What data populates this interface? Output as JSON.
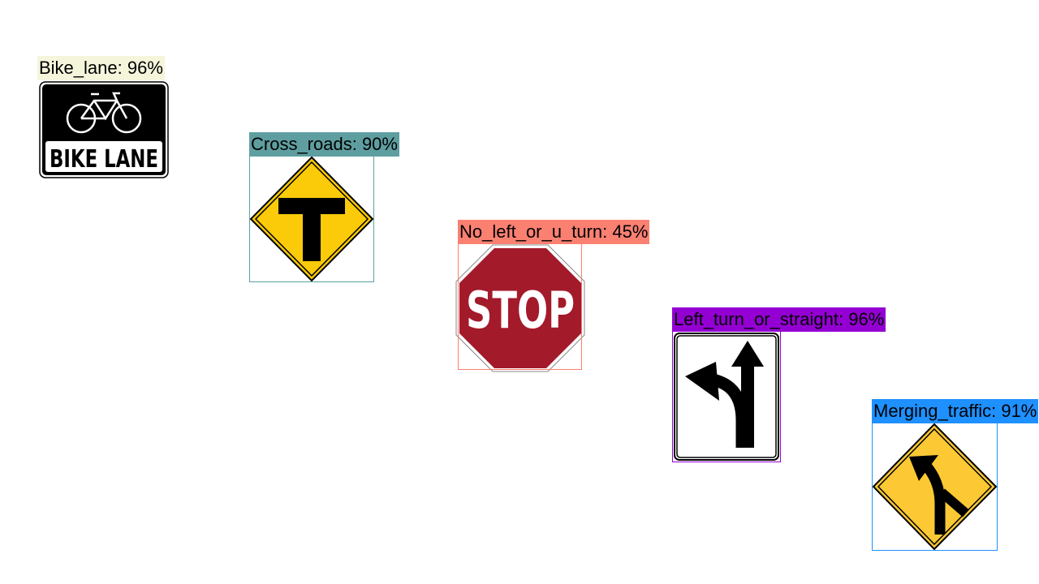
{
  "detections": [
    {
      "label": "Bike_lane: 96%",
      "color": "#f5f5dc",
      "sign_icon": "bike-lane-sign",
      "sign_text": "BIKE LANE"
    },
    {
      "label": "Cross_roads: 90%",
      "color": "#5f9ea0",
      "sign_icon": "t-intersection-sign"
    },
    {
      "label": "No_left_or_u_turn: 45%",
      "color": "#fa8072",
      "sign_icon": "stop-sign",
      "sign_text": "STOP"
    },
    {
      "label": "Left_turn_or_straight: 96%",
      "color": "#9400d3",
      "sign_icon": "left-turn-or-straight-sign"
    },
    {
      "label": "Merging_traffic: 91%",
      "color": "#1e90ff",
      "sign_icon": "merging-traffic-sign"
    }
  ]
}
